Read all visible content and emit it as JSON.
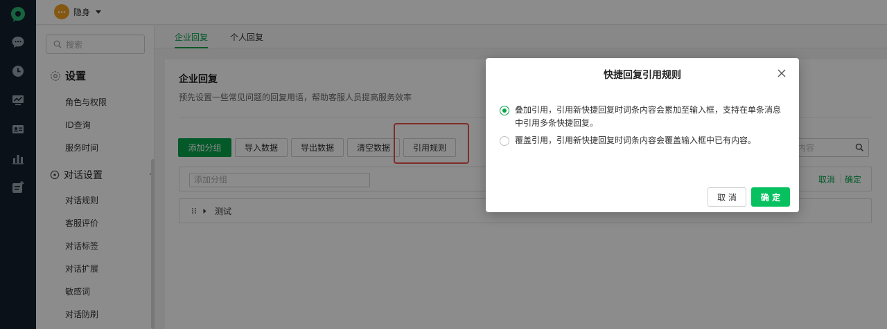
{
  "header": {
    "status_label": "隐身",
    "status_icon": "chat-bubble-avatar-icon",
    "caret_icon": "caret-down-icon"
  },
  "rail": {
    "icons": [
      "logo-icon",
      "message-icon",
      "history-clock-icon",
      "monitor-chart-icon",
      "contact-card-icon",
      "stats-bar-icon",
      "app-plus-icon"
    ]
  },
  "sidebar": {
    "search_placeholder": "搜索",
    "settings_title": "设置",
    "settings_items": [
      "角色与权限",
      "ID查询",
      "服务时间"
    ],
    "dialog_settings_title": "对话设置",
    "dialog_items": [
      "对话规则",
      "客服评价",
      "对话标签",
      "对话扩展",
      "敏感词",
      "对话防刷"
    ]
  },
  "tabs": {
    "enterprise": "企业回复",
    "personal": "个人回复"
  },
  "card": {
    "title": "企业回复",
    "description": "预先设置一些常见问题的回复用语，帮助客服人员提高服务效率",
    "buttons": {
      "add_group": "添加分组",
      "import": "导入数据",
      "export": "导出数据",
      "clear": "清空数据",
      "quote_rules": "引用规则"
    },
    "search_partial": "内容",
    "add_group_placeholder": "添加分组",
    "cancel_link": "取消",
    "confirm_link": "确定",
    "group_name": "测试"
  },
  "dialog": {
    "title": "快捷回复引用规则",
    "option_stack": "叠加引用，引用新快捷回复时词条内容会累加至输入框，支持在单条消息中引用多条快捷回复。",
    "option_overwrite": "覆盖引用，引用新快捷回复时词条内容会覆盖输入框中已有内容。",
    "selected": "stack",
    "cancel": "取 消",
    "confirm": "确 定"
  },
  "colors": {
    "accent": "#07a34a",
    "confirm_green": "#07c160",
    "rail_bg": "#13202d",
    "highlight_red": "#e8504a"
  }
}
